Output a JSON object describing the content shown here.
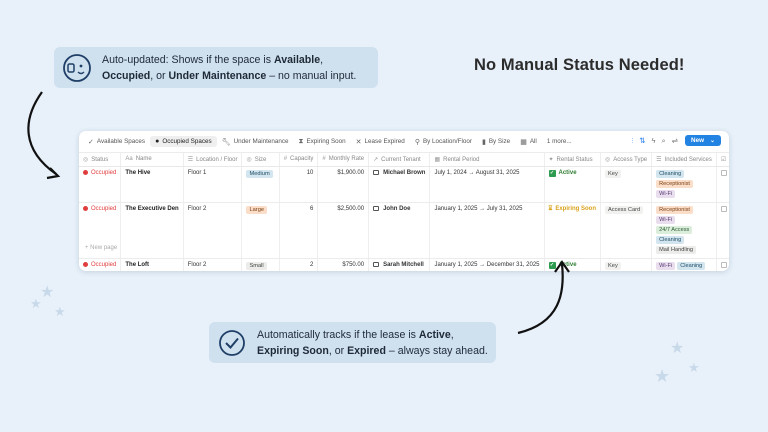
{
  "callout_top": {
    "icon": "ai-face-icon",
    "pre": "Auto-updated: Shows if the space is ",
    "b1": "Available",
    "mid1": ", ",
    "b2": "Occupied",
    "mid2": ", or ",
    "b3": "Under Maintenance",
    "post": " – no manual input."
  },
  "headline": "No Manual Status Needed!",
  "callout_bottom": {
    "icon": "checkmark-circle-icon",
    "pre": "Automatically tracks if the lease is ",
    "b1": "Active",
    "mid1": ", ",
    "b2": "Expiring Soon",
    "mid2": ", or ",
    "b3": "Expired",
    "post": " – always stay ahead."
  },
  "tabs": [
    {
      "icon": "check-icon",
      "label": "Available Spaces",
      "active": false
    },
    {
      "icon": "dot-icon",
      "label": "Occupied Spaces",
      "active": true
    },
    {
      "icon": "wrench-icon",
      "label": "Under Maintenance",
      "active": false
    },
    {
      "icon": "hourglass-icon",
      "label": "Expiring Soon",
      "active": false
    },
    {
      "icon": "x-icon",
      "label": "Lease Expired",
      "active": false
    },
    {
      "icon": "pin-icon",
      "label": "By Location/Floor",
      "active": false
    },
    {
      "icon": "bar-icon",
      "label": "By Size",
      "active": false
    },
    {
      "icon": "grid-icon",
      "label": "All",
      "active": false
    },
    {
      "icon": "",
      "label": "1 more...",
      "active": false
    }
  ],
  "toolbar": {
    "new_label": "New"
  },
  "columns": [
    {
      "icon": "◎",
      "label": "Status"
    },
    {
      "icon": "Aa",
      "label": "Name"
    },
    {
      "icon": "☰",
      "label": "Location / Floor"
    },
    {
      "icon": "◎",
      "label": "Size"
    },
    {
      "icon": "#",
      "label": "Capacity"
    },
    {
      "icon": "#",
      "label": "Monthly Rate"
    },
    {
      "icon": "↗",
      "label": "Current Tenant"
    },
    {
      "icon": "▦",
      "label": "Rental Period"
    },
    {
      "icon": "✦",
      "label": "Rental Status"
    },
    {
      "icon": "◎",
      "label": "Access Type"
    },
    {
      "icon": "☰",
      "label": "Included Services"
    },
    {
      "icon": "☑",
      "label": ""
    }
  ],
  "rows": [
    {
      "status": "Occupied",
      "name": "The Hive",
      "location": "Floor 1",
      "size": "Medium",
      "size_class": "sz-medium",
      "capacity": "10",
      "rate": "$1,900.00",
      "tenant": "Michael Brown",
      "period": "July 1, 2024 → August 31, 2025",
      "rental_status": "Active",
      "rental_class": "active",
      "access": "Key",
      "services": [
        {
          "label": "Cleaning",
          "cls": "svc-cleaning"
        },
        {
          "label": "Receptionist",
          "cls": "svc-reception"
        },
        {
          "label": "Wi-Fi",
          "cls": "svc-wifi"
        }
      ]
    },
    {
      "status": "Occupied",
      "name": "The Executive Den",
      "location": "Floor 2",
      "size": "Large",
      "size_class": "sz-large",
      "capacity": "6",
      "rate": "$2,500.00",
      "tenant": "John Doe",
      "period": "January 1, 2025 → July 31, 2025",
      "rental_status": "Expiring Soon",
      "rental_class": "soon",
      "access": "Access Card",
      "services": [
        {
          "label": "Receptionist",
          "cls": "svc-reception"
        },
        {
          "label": "Wi-Fi",
          "cls": "svc-wifi"
        },
        {
          "label": "24/7 Access",
          "cls": "svc-access"
        },
        {
          "label": "Cleaning",
          "cls": "svc-cleaning"
        },
        {
          "label": "Mail Handling",
          "cls": "svc-mail"
        }
      ]
    },
    {
      "status": "Occupied",
      "name": "The Loft",
      "location": "Floor 2",
      "size": "Small",
      "size_class": "sz-small",
      "capacity": "2",
      "rate": "$750.00",
      "tenant": "Sarah Mitchell",
      "period": "January 1, 2025 → December 31, 2025",
      "rental_status": "Active",
      "rental_class": "active",
      "access": "Key",
      "services": [
        {
          "label": "Wi-Fi",
          "cls": "svc-wifi"
        },
        {
          "label": "Cleaning",
          "cls": "svc-cleaning"
        }
      ]
    }
  ],
  "new_page_label": "+ New page"
}
